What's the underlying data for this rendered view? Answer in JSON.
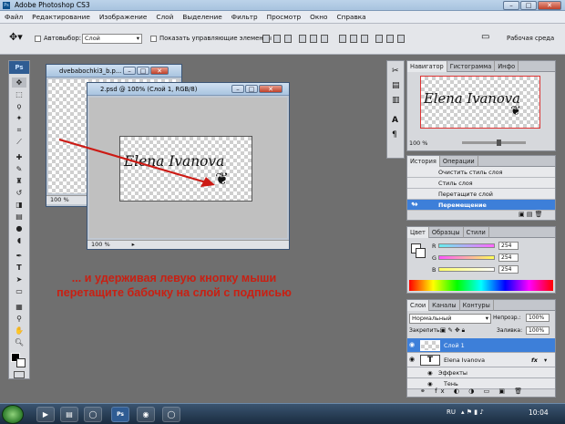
{
  "app": {
    "title": "Adobe Photoshop CS3",
    "logo_text": "Ps"
  },
  "menu": [
    "Файл",
    "Редактирование",
    "Изображение",
    "Слой",
    "Выделение",
    "Фильтр",
    "Просмотр",
    "Окно",
    "Справка"
  ],
  "options": {
    "autoselect_label": "Автовыбор:",
    "autoselect_value": "Слой",
    "show_controls_label": "Показать управляющие элементы",
    "workspace_label": "Рабочая среда"
  },
  "doc_back": {
    "title": "dvebabochki3_b.p...",
    "zoom": "100 %"
  },
  "doc_front": {
    "title": "2.psd @ 100% (Слой 1, RGB/8)",
    "zoom": "100 %",
    "signature": "Elena Ivanova"
  },
  "caption": {
    "line1": "... и удерживая левую кнопку мыши",
    "line2": "перетащите бабочку на слой с подписью"
  },
  "navigator": {
    "tabs": [
      "Навигатор",
      "Гистограмма",
      "Инфо"
    ],
    "zoom": "100 %",
    "signature": "Elena Ivanova"
  },
  "history": {
    "tabs": [
      "История",
      "Операции"
    ],
    "items": [
      {
        "label": "Очистить стиль слоя",
        "active": false
      },
      {
        "label": "Стиль слоя",
        "active": false
      },
      {
        "label": "Перетащите слой",
        "active": false
      },
      {
        "label": "Перемещение",
        "active": true
      }
    ]
  },
  "color": {
    "tabs": [
      "Цвет",
      "Образцы",
      "Стили"
    ],
    "channels": [
      {
        "label": "R",
        "value": "254",
        "color": "#e2303a"
      },
      {
        "label": "G",
        "value": "254",
        "color": "#2fc24a"
      },
      {
        "label": "B",
        "value": "254",
        "color": "#2c52e6"
      }
    ]
  },
  "layers": {
    "tabs": [
      "Слои",
      "Каналы",
      "Контуры"
    ],
    "mode": "Нормальный",
    "opacity_label": "Непрозр.:",
    "opacity": "100%",
    "lock_label": "Закрепить:",
    "fill_label": "Заливка:",
    "fill": "100%",
    "rows": [
      {
        "name": "Слой 1",
        "active": true
      },
      {
        "name": "Elena Ivanova",
        "active": false
      },
      {
        "name": "Эффекты",
        "active": false
      },
      {
        "name": "Тень",
        "active": false
      }
    ]
  },
  "taskbar": {
    "lang": "RU",
    "time": "10:04"
  },
  "colors": {
    "accent": "#3d7fd9",
    "arrow": "#cc1a14",
    "caption": "#c82013"
  }
}
